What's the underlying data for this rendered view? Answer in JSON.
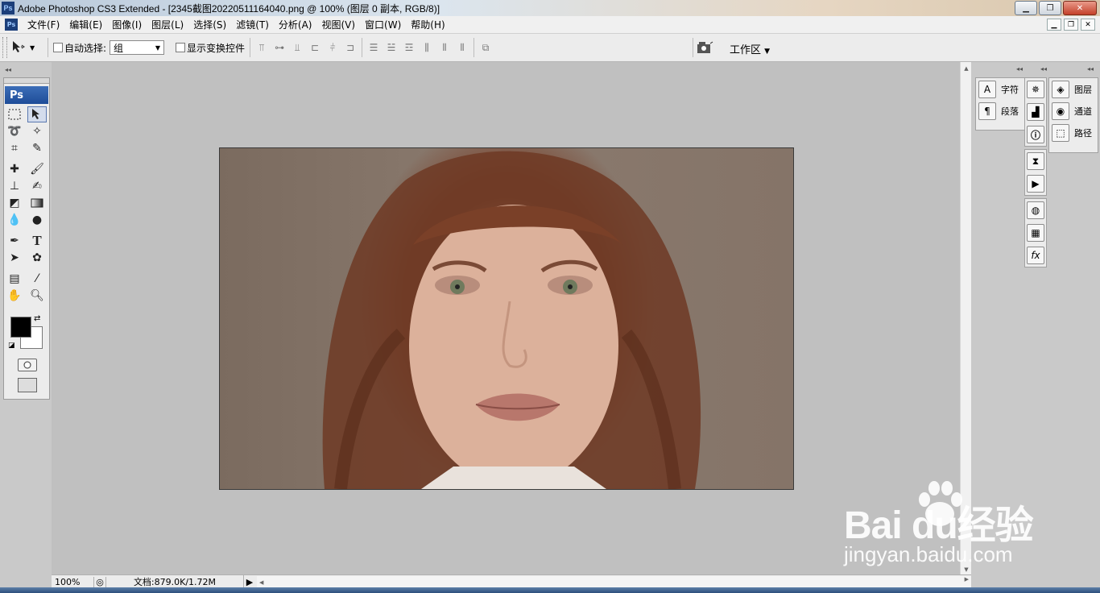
{
  "window": {
    "title": "Adobe Photoshop CS3 Extended - [2345截图20220511164040.png @ 100% (图层 0 副本, RGB/8)]",
    "app_icon": "Ps"
  },
  "menu": {
    "items": [
      "文件(F)",
      "编辑(E)",
      "图像(I)",
      "图层(L)",
      "选择(S)",
      "滤镜(T)",
      "分析(A)",
      "视图(V)",
      "窗口(W)",
      "帮助(H)"
    ]
  },
  "options": {
    "auto_select_label": "自动选择:",
    "auto_select_value": "组",
    "show_transform_label": "显示变换控件",
    "workspace_label": "工作区"
  },
  "toolbox": {
    "header": "Ps"
  },
  "panels": {
    "col1": [
      {
        "icon": "character-icon",
        "glyph": "A",
        "label": "字符"
      },
      {
        "icon": "paragraph-icon",
        "glyph": "¶",
        "label": "段落"
      }
    ],
    "col3": [
      {
        "icon": "layers-icon",
        "glyph": "◈",
        "label": "图层"
      },
      {
        "icon": "channels-icon",
        "glyph": "◉",
        "label": "通道"
      },
      {
        "icon": "paths-icon",
        "glyph": "⬚",
        "label": "路径"
      }
    ]
  },
  "status": {
    "zoom": "100%",
    "doc_info": "文档:879.0K/1.72M"
  },
  "watermark": {
    "brand": "Bai du经验",
    "url": "jingyan.baidu.com"
  }
}
